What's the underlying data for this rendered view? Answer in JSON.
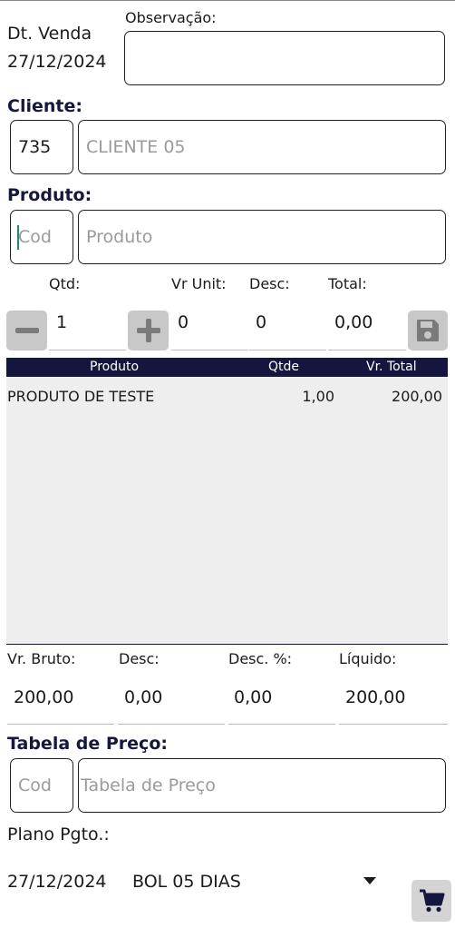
{
  "header": {
    "date_label": "Dt. Venda",
    "date_value": "27/12/2024",
    "obs_label": "Observação:",
    "obs_value": ""
  },
  "cliente": {
    "label": "Cliente:",
    "code": "735",
    "name_placeholder": "CLIENTE 05"
  },
  "produto": {
    "label": "Produto:",
    "code_placeholder": "Cod",
    "name_placeholder": "Produto"
  },
  "item_entry": {
    "qtd_label": "Qtd:",
    "vr_unit_label": "Vr Unit:",
    "desc_label": "Desc:",
    "total_label": "Total:",
    "qtd_value": "1",
    "vr_unit_value": "0",
    "desc_value": "0",
    "total_value": "0,00"
  },
  "table": {
    "headers": [
      "Produto",
      "Qtde",
      "Vr. Total"
    ],
    "rows": [
      {
        "produto": "PRODUTO DE TESTE",
        "qtde": "1,00",
        "total": "200,00"
      }
    ]
  },
  "totals": {
    "bruto_label": "Vr. Bruto:",
    "desc_label": "Desc:",
    "desc_pct_label": "Desc. %:",
    "liquido_label": "Líquido:",
    "bruto_value": "200,00",
    "desc_value": "0,00",
    "desc_pct_value": "0,00",
    "liquido_value": "200,00"
  },
  "tabela_preco": {
    "label": "Tabela de Preço:",
    "code_placeholder": "Cod",
    "name_placeholder": "Tabela de Preço"
  },
  "plano": {
    "label": "Plano Pgto.:",
    "date": "27/12/2024",
    "value": "BOL 05 DIAS"
  },
  "icons": {
    "minus": "minus-icon",
    "plus": "plus-icon",
    "save": "floppy-disk-icon",
    "dropdown": "caret-down-icon",
    "cart": "shopping-cart-icon"
  },
  "colors": {
    "accent_dark": "#14163d",
    "icon_gray": "#c8c8c8",
    "cursor": "#1b8a7c"
  }
}
